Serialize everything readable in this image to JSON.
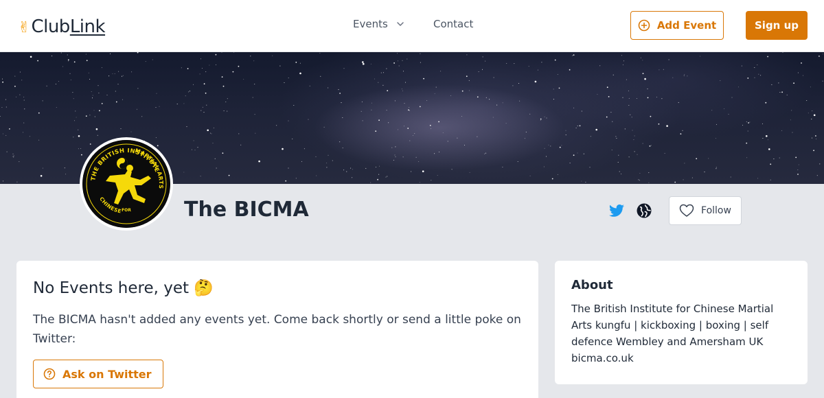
{
  "header": {
    "logo": {
      "icon": "victory-hand-icon",
      "club": "Club",
      "link": "Link"
    },
    "nav": {
      "events_label": "Events",
      "contact_label": "Contact"
    },
    "add_event_label": "Add Event",
    "sign_up_label": "Sign up"
  },
  "profile": {
    "name": "The BICMA",
    "logo_text": "THE BRITISH INSTITUTE FOR CHINESE MARTIAL ARTS",
    "follow_label": "Follow"
  },
  "events": {
    "title": "No Events here, yet 🤔",
    "message": "The BICMA hasn't added any events yet. Come back shortly or send a little poke on Twitter:",
    "ask_button_label": "Ask on Twitter"
  },
  "about": {
    "title": "About",
    "description": "The British Institute for Chinese Martial Arts kungfu | kickboxing | boxing | self defence Wembley and Amersham UK",
    "website": "bicma.co.uk"
  },
  "colors": {
    "accent": "#d97706",
    "twitter": "#1d9bf0",
    "background": "#e5e7eb"
  }
}
